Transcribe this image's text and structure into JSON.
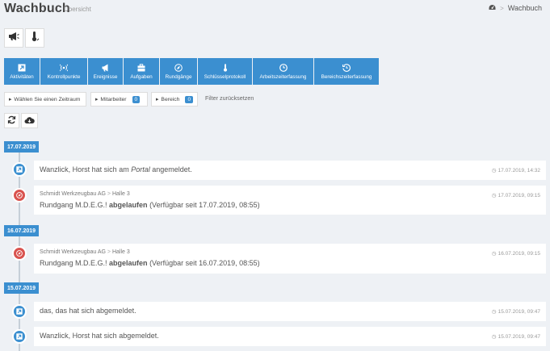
{
  "header": {
    "title": "Wachbuch",
    "subtitle": "Übersicht",
    "breadcrumb": {
      "current": "Wachbuch",
      "sep": ">"
    }
  },
  "toolbar": [
    {
      "label": "Aktivitäten",
      "icon": "external-link-icon"
    },
    {
      "label": "Kontrollpunkte",
      "icon": "broadcast-icon"
    },
    {
      "label": "Ereignisse",
      "icon": "megaphone-icon"
    },
    {
      "label": "Aufgaben",
      "icon": "briefcase-icon"
    },
    {
      "label": "Rundgänge",
      "icon": "compass-icon"
    },
    {
      "label": "Schlüsselprotokoll",
      "icon": "thermometer-icon"
    },
    {
      "label": "Arbeitszeiterfassung",
      "icon": "clock-icon"
    },
    {
      "label": "Bereichszeiterfassung",
      "icon": "history-icon"
    }
  ],
  "filters": {
    "period_label": "Wählen Sie einen Zeitraum",
    "staff_label": "Mitarbeiter",
    "staff_count": "0",
    "area_label": "Bereich",
    "area_count": "0",
    "reset_label": "Filter zurücksetzen"
  },
  "timeline": {
    "dates": [
      "17.07.2019",
      "16.07.2019",
      "15.07.2019"
    ],
    "entries": [
      {
        "t1": "Wanzlick, Horst hat sich am ",
        "t2": "Portal",
        "t3": " angemeldet.",
        "time": "17.07.2019, 14:32",
        "color": "#3b8fd0"
      },
      {
        "meta1": "Schmidt Werkzeugbau AG",
        "meta_sep": ">",
        "meta2": "Halle 3",
        "t1": "Rundgang M.D.E.G.! ",
        "t2": "abgelaufen",
        "t3": " (Verfügbar seit 17.07.2019, 08:55)",
        "time": "17.07.2019, 09:15",
        "color": "#d9534f"
      },
      {
        "meta1": "Schmidt Werkzeugbau AG",
        "meta_sep": ">",
        "meta2": "Halle 3",
        "t1": "Rundgang M.D.E.G.! ",
        "t2": "abgelaufen",
        "t3": " (Verfügbar seit 16.07.2019, 08:55)",
        "time": "16.07.2019, 09:15",
        "color": "#d9534f"
      },
      {
        "t1": "das, das hat sich abgemeldet.",
        "time": "15.07.2019, 09:47",
        "color": "#3b8fd0"
      },
      {
        "t1": "Wanzlick, Horst hat sich abgemeldet.",
        "time": "15.07.2019, 09:47",
        "color": "#3b8fd0"
      }
    ]
  }
}
